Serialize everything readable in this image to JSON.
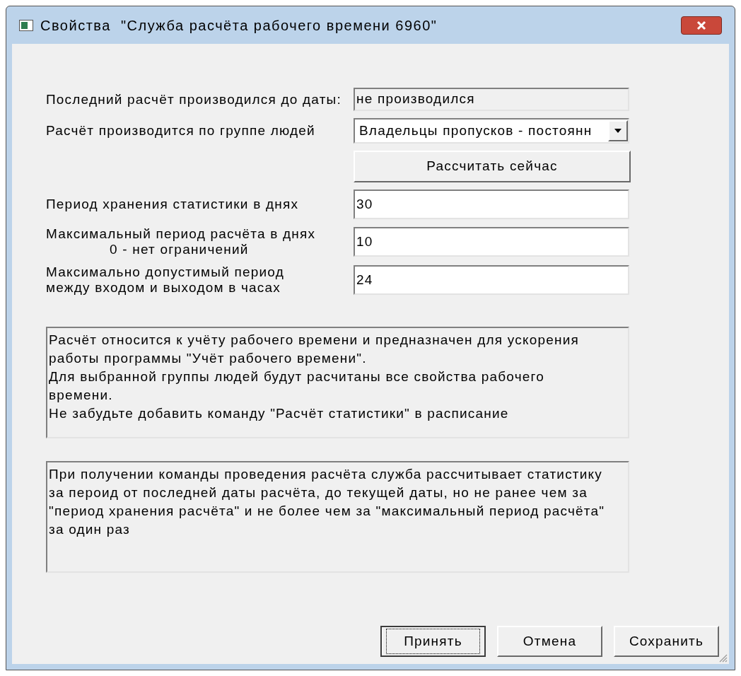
{
  "window": {
    "title": "Свойства  \"Служба расчёта рабочего времени 6960\""
  },
  "rows": [
    {
      "kind": "readonly",
      "label": [
        "Последний расчёт производился до даты:"
      ],
      "value": "не производился"
    },
    {
      "kind": "dropdown",
      "label": [
        "Расчёт производится по группе людей"
      ],
      "value": "Владельцы пропусков - постоянн"
    },
    {
      "kind": "button",
      "label": [],
      "value": "Рассчитать сейчас"
    },
    {
      "kind": "input",
      "label": [
        "Период хранения статистики в днях"
      ],
      "value": "30"
    },
    {
      "kind": "input",
      "label": [
        "Максимальный период расчёта в днях",
        "0 - нет ограничений"
      ],
      "value": "10"
    },
    {
      "kind": "input",
      "label": [
        "Максимально допустимый период",
        "между входом и выходом в часах"
      ],
      "value": "24"
    }
  ],
  "notes": [
    {
      "lines": [
        "Расчёт относится к учёту рабочего времени и предназначен для ускорения",
        "работы программы \"Учёт рабочего времени\".",
        "Для выбранной группы людей будут расчитаны все свойства рабочего",
        "времени.",
        "Не забудьте добавить команду \"Расчёт статистики\" в расписание"
      ]
    },
    {
      "lines": [
        "При получении команды проведения расчёта служба рассчитывает статистику",
        "за пероид от последней даты расчёта, до текущей даты, но не ранее чем за",
        "\"период хранения расчёта\" и не более чем за \"максимальный период расчёта\"",
        "за один раз"
      ]
    }
  ],
  "buttons": [
    {
      "label": "Принять",
      "focused": true
    },
    {
      "label": "Отмена",
      "focused": false
    },
    {
      "label": "Сохранить",
      "focused": false
    }
  ]
}
